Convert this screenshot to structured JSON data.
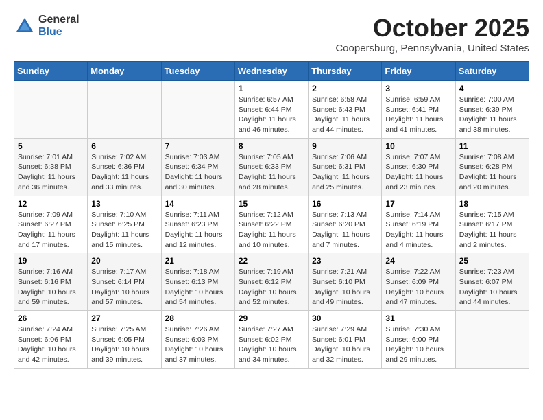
{
  "header": {
    "logo_general": "General",
    "logo_blue": "Blue",
    "title": "October 2025",
    "location": "Coopersburg, Pennsylvania, United States"
  },
  "days_of_week": [
    "Sunday",
    "Monday",
    "Tuesday",
    "Wednesday",
    "Thursday",
    "Friday",
    "Saturday"
  ],
  "weeks": [
    [
      {
        "day": "",
        "info": ""
      },
      {
        "day": "",
        "info": ""
      },
      {
        "day": "",
        "info": ""
      },
      {
        "day": "1",
        "info": "Sunrise: 6:57 AM\nSunset: 6:44 PM\nDaylight: 11 hours and 46 minutes."
      },
      {
        "day": "2",
        "info": "Sunrise: 6:58 AM\nSunset: 6:43 PM\nDaylight: 11 hours and 44 minutes."
      },
      {
        "day": "3",
        "info": "Sunrise: 6:59 AM\nSunset: 6:41 PM\nDaylight: 11 hours and 41 minutes."
      },
      {
        "day": "4",
        "info": "Sunrise: 7:00 AM\nSunset: 6:39 PM\nDaylight: 11 hours and 38 minutes."
      }
    ],
    [
      {
        "day": "5",
        "info": "Sunrise: 7:01 AM\nSunset: 6:38 PM\nDaylight: 11 hours and 36 minutes."
      },
      {
        "day": "6",
        "info": "Sunrise: 7:02 AM\nSunset: 6:36 PM\nDaylight: 11 hours and 33 minutes."
      },
      {
        "day": "7",
        "info": "Sunrise: 7:03 AM\nSunset: 6:34 PM\nDaylight: 11 hours and 30 minutes."
      },
      {
        "day": "8",
        "info": "Sunrise: 7:05 AM\nSunset: 6:33 PM\nDaylight: 11 hours and 28 minutes."
      },
      {
        "day": "9",
        "info": "Sunrise: 7:06 AM\nSunset: 6:31 PM\nDaylight: 11 hours and 25 minutes."
      },
      {
        "day": "10",
        "info": "Sunrise: 7:07 AM\nSunset: 6:30 PM\nDaylight: 11 hours and 23 minutes."
      },
      {
        "day": "11",
        "info": "Sunrise: 7:08 AM\nSunset: 6:28 PM\nDaylight: 11 hours and 20 minutes."
      }
    ],
    [
      {
        "day": "12",
        "info": "Sunrise: 7:09 AM\nSunset: 6:27 PM\nDaylight: 11 hours and 17 minutes."
      },
      {
        "day": "13",
        "info": "Sunrise: 7:10 AM\nSunset: 6:25 PM\nDaylight: 11 hours and 15 minutes."
      },
      {
        "day": "14",
        "info": "Sunrise: 7:11 AM\nSunset: 6:23 PM\nDaylight: 11 hours and 12 minutes."
      },
      {
        "day": "15",
        "info": "Sunrise: 7:12 AM\nSunset: 6:22 PM\nDaylight: 11 hours and 10 minutes."
      },
      {
        "day": "16",
        "info": "Sunrise: 7:13 AM\nSunset: 6:20 PM\nDaylight: 11 hours and 7 minutes."
      },
      {
        "day": "17",
        "info": "Sunrise: 7:14 AM\nSunset: 6:19 PM\nDaylight: 11 hours and 4 minutes."
      },
      {
        "day": "18",
        "info": "Sunrise: 7:15 AM\nSunset: 6:17 PM\nDaylight: 11 hours and 2 minutes."
      }
    ],
    [
      {
        "day": "19",
        "info": "Sunrise: 7:16 AM\nSunset: 6:16 PM\nDaylight: 10 hours and 59 minutes."
      },
      {
        "day": "20",
        "info": "Sunrise: 7:17 AM\nSunset: 6:14 PM\nDaylight: 10 hours and 57 minutes."
      },
      {
        "day": "21",
        "info": "Sunrise: 7:18 AM\nSunset: 6:13 PM\nDaylight: 10 hours and 54 minutes."
      },
      {
        "day": "22",
        "info": "Sunrise: 7:19 AM\nSunset: 6:12 PM\nDaylight: 10 hours and 52 minutes."
      },
      {
        "day": "23",
        "info": "Sunrise: 7:21 AM\nSunset: 6:10 PM\nDaylight: 10 hours and 49 minutes."
      },
      {
        "day": "24",
        "info": "Sunrise: 7:22 AM\nSunset: 6:09 PM\nDaylight: 10 hours and 47 minutes."
      },
      {
        "day": "25",
        "info": "Sunrise: 7:23 AM\nSunset: 6:07 PM\nDaylight: 10 hours and 44 minutes."
      }
    ],
    [
      {
        "day": "26",
        "info": "Sunrise: 7:24 AM\nSunset: 6:06 PM\nDaylight: 10 hours and 42 minutes."
      },
      {
        "day": "27",
        "info": "Sunrise: 7:25 AM\nSunset: 6:05 PM\nDaylight: 10 hours and 39 minutes."
      },
      {
        "day": "28",
        "info": "Sunrise: 7:26 AM\nSunset: 6:03 PM\nDaylight: 10 hours and 37 minutes."
      },
      {
        "day": "29",
        "info": "Sunrise: 7:27 AM\nSunset: 6:02 PM\nDaylight: 10 hours and 34 minutes."
      },
      {
        "day": "30",
        "info": "Sunrise: 7:29 AM\nSunset: 6:01 PM\nDaylight: 10 hours and 32 minutes."
      },
      {
        "day": "31",
        "info": "Sunrise: 7:30 AM\nSunset: 6:00 PM\nDaylight: 10 hours and 29 minutes."
      },
      {
        "day": "",
        "info": ""
      }
    ]
  ]
}
